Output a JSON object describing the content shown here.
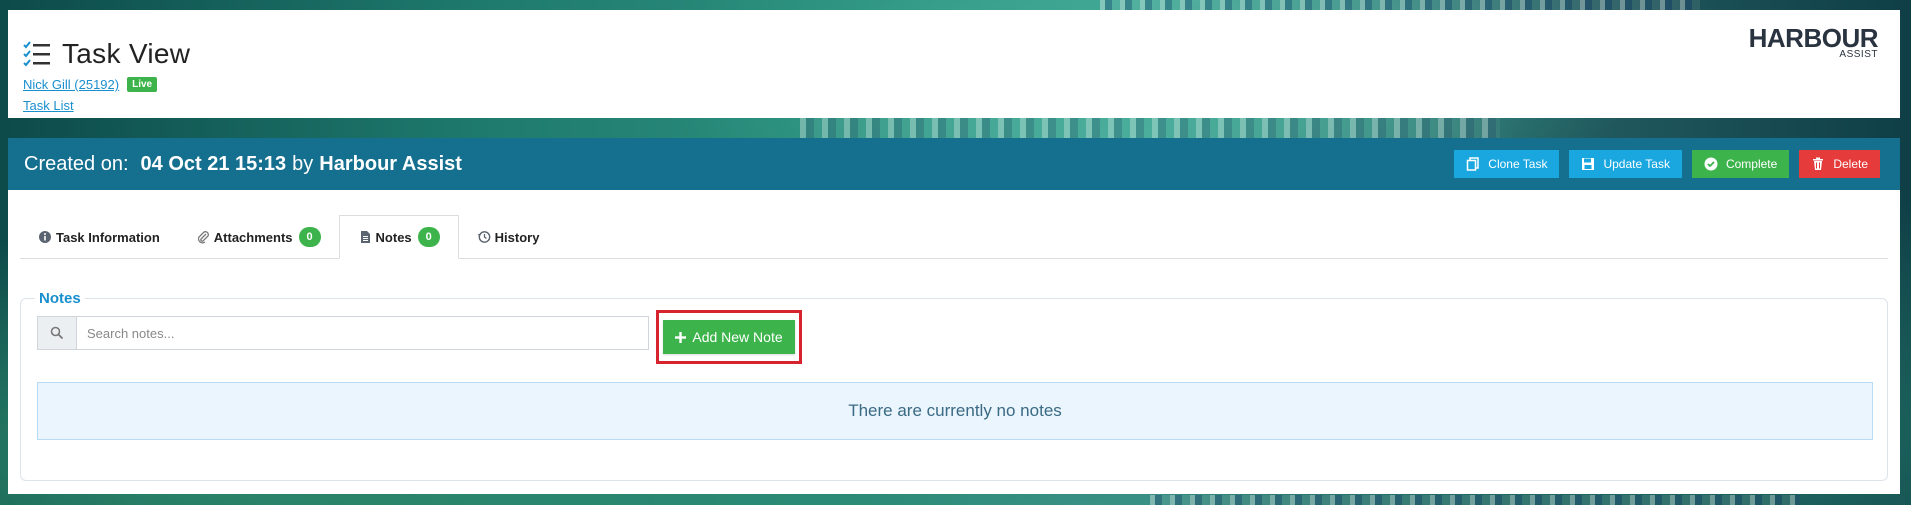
{
  "header": {
    "title": "Task View",
    "user_link": "Nick Gill (25192)",
    "status_badge": "Live",
    "task_list_link": "Task List",
    "logo_main": "HARBOUR",
    "logo_sub": "ASSIST"
  },
  "task": {
    "created_label": "Created on:",
    "created_date": "04 Oct 21 15:13",
    "by_label": "by",
    "created_by": "Harbour Assist",
    "actions": {
      "clone": "Clone Task",
      "update": "Update Task",
      "complete": "Complete",
      "delete": "Delete"
    }
  },
  "tabs": {
    "info": "Task Information",
    "attachments": "Attachments",
    "attachments_count": "0",
    "notes": "Notes",
    "notes_count": "0",
    "history": "History"
  },
  "notes": {
    "legend": "Notes",
    "search_placeholder": "Search notes...",
    "add_button": "Add New Note",
    "empty_message": "There are currently no notes"
  },
  "colors": {
    "primary_bar": "#156f8f",
    "accent_blue": "#1aa7e0",
    "success": "#3cb44b",
    "danger": "#e63b3b",
    "highlight_border": "#d7232e"
  }
}
